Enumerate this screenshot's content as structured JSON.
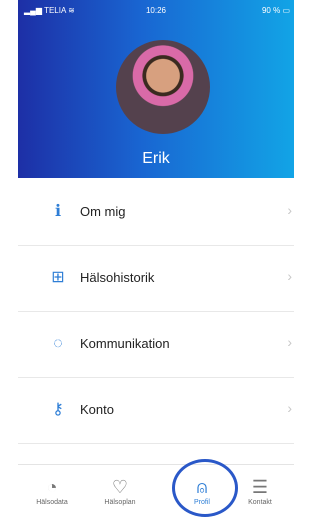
{
  "status": {
    "carrier": "TELIA",
    "time": "10:26",
    "battery": "90 %"
  },
  "profile": {
    "name": "Erik"
  },
  "menu": {
    "items": [
      {
        "label": "Om mig",
        "icon": "info-icon"
      },
      {
        "label": "Hälsohistorik",
        "icon": "medical-kit-icon"
      },
      {
        "label": "Kommunikation",
        "icon": "chat-bubble-icon"
      },
      {
        "label": "Konto",
        "icon": "key-icon"
      }
    ]
  },
  "tabs": [
    {
      "label": "Hälsodata",
      "icon": "gauge-icon"
    },
    {
      "label": "Hälsoplan",
      "icon": "heart-icon"
    },
    {
      "label": "Profil",
      "icon": "person-icon",
      "active": true
    },
    {
      "label": "Kontakt",
      "icon": "message-icon"
    }
  ],
  "colors": {
    "accent": "#2e7ed6",
    "header_start": "#1d2fa6",
    "header_end": "#12a4e6",
    "ring": "#2a58c8"
  }
}
